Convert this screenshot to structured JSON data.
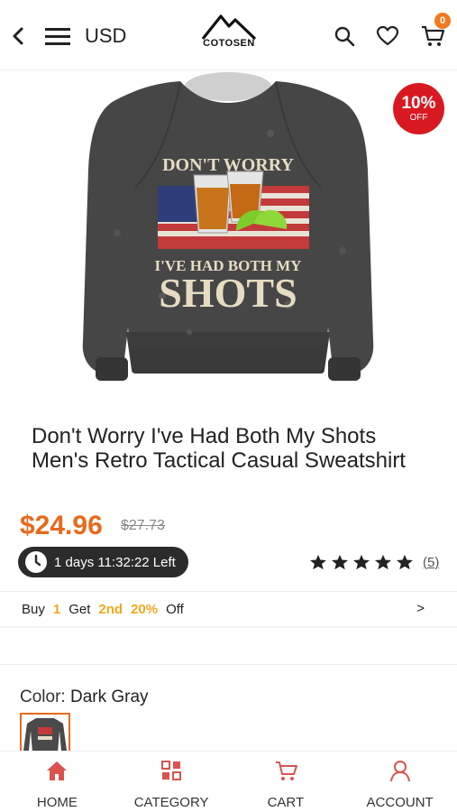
{
  "header": {
    "currency": "USD",
    "logo_text": "COTOSEN",
    "cart_count": "0"
  },
  "hero": {
    "discount_percent": "10%",
    "discount_suffix": "OFF",
    "shirt_text_line1": "DON'T WORRY",
    "shirt_text_line2": "I'VE HAD BOTH MY",
    "shirt_text_line3": "SHOTS"
  },
  "product": {
    "title": "Don't Worry I've Had Both My Shots Men's Retro Tactical Casual Sweatshirt",
    "price": "$24.96",
    "original_price": "$27.73",
    "countdown": "1 days 11:32:22 Left",
    "rating_stars": 5,
    "review_count": "(5)"
  },
  "promo": {
    "buy_label": "Buy",
    "buy_qty": "1",
    "get_label": "Get",
    "get_item": "2nd",
    "discount": "20%",
    "off_label": "Off",
    "arrow": ">"
  },
  "options": {
    "color_label": "Color:",
    "color_value": "Dark Gray"
  },
  "bottom_nav": {
    "home": "HOME",
    "category": "CATEGORY",
    "cart": "CART",
    "account": "ACCOUNT"
  },
  "colors": {
    "accent": "#e76a1b",
    "discount_badge": "#d91921",
    "promo_highlight": "#f2a81b",
    "nav_icon": "#d9534f"
  },
  "icons": [
    "back-arrow-icon",
    "hamburger-menu-icon",
    "mountain-logo-icon",
    "search-icon",
    "heart-icon",
    "cart-icon",
    "clock-icon",
    "star-icon",
    "home-icon",
    "category-icon",
    "cart-icon",
    "account-icon"
  ]
}
